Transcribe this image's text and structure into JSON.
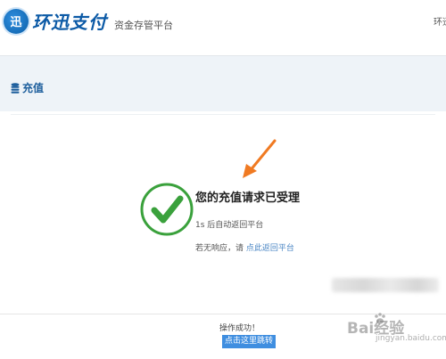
{
  "header": {
    "logo_mark": "迅",
    "brand_name": "环迅支付",
    "brand_sub": "资金存管平台",
    "right_text": "环迅"
  },
  "section": {
    "title": "充值",
    "icon": "database-icon"
  },
  "result": {
    "title": "您的充值请求已受理",
    "auto_return": "1s 后自动返回平台",
    "no_response_prefix": "若无响应，请 ",
    "no_response_link": "点此返回平台",
    "icon": "check-circle-icon",
    "accent_color": "#3aa13c"
  },
  "footer": {
    "status": "操作成功！",
    "jump_button": "点击这里跳转",
    "button_color": "#3f8ee0"
  },
  "watermark": {
    "brand": "Bai经验",
    "url": "jingyan.baidu.com"
  },
  "annotation": {
    "icon": "arrow-icon",
    "color": "#f07a22"
  }
}
